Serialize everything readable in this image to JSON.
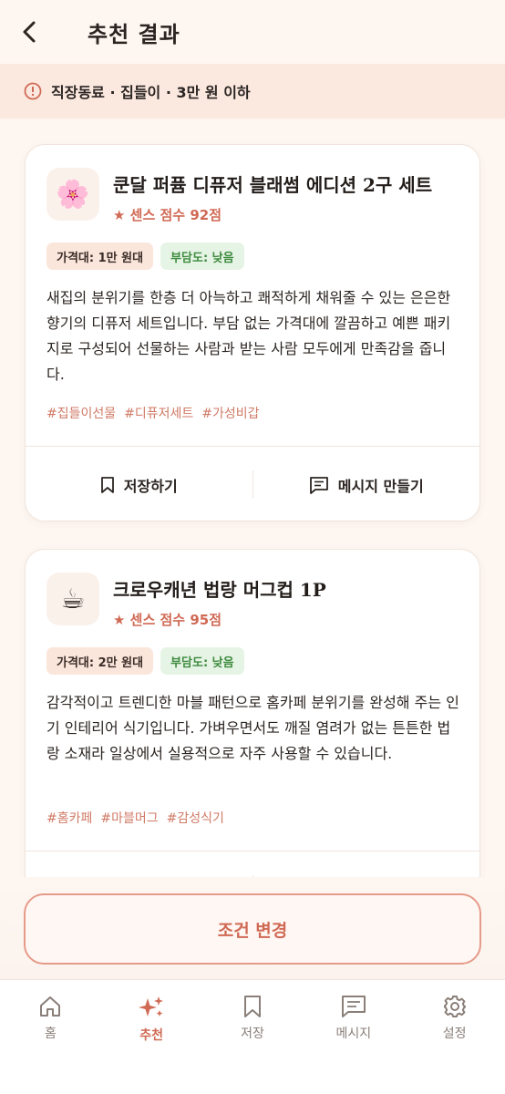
{
  "header": {
    "title": "추천 결과"
  },
  "conditions": {
    "text": "직장동료 · 집들이 · 3만 원 이하"
  },
  "products": [
    {
      "icon": "cherry-blossom-icon",
      "emoji": "🌸",
      "name": "쿤달 퍼퓸 디퓨저 블래썸 에디션 2구 세트",
      "score": "★ 센스 점수 92점",
      "price_badge": "가격대: 1만 원대",
      "burden_badge": "부담도: 낮음",
      "description": "새집의 분위기를 한층 더 아늑하고 쾌적하게 채워줄 수 있는 은은한 향기의 디퓨저 세트입니다. 부담 없는 가격대에 깔끔하고 예쁜 패키지로 구성되어 선물하는 사람과 받는 사람 모두에게 만족감을 줍니다.",
      "tags": [
        "#집들이선물",
        "#디퓨저세트",
        "#가성비갑"
      ]
    },
    {
      "icon": "coffee-cup-icon",
      "emoji": "☕",
      "name": "크로우캐년 법랑 머그컵 1P",
      "score": "★ 센스 점수 95점",
      "price_badge": "가격대: 2만 원대",
      "burden_badge": "부담도: 낮음",
      "description": "감각적이고 트렌디한 마블 패턴으로 홈카페 분위기를 완성해 주는 인기 인테리어 식기입니다. 가벼우면서도 깨질 염려가 없는 튼튼한 법랑 소재라 일상에서 실용적으로 자주 사용할 수 있습니다.",
      "tags": [
        "#홈카페",
        "#마블머그",
        "#감성식기"
      ]
    }
  ],
  "actions": {
    "save": "저장하기",
    "message": "메시지 만들기"
  },
  "cta": {
    "label": "조건 변경"
  },
  "nav": [
    {
      "label": "홈",
      "icon": "home-icon"
    },
    {
      "label": "추천",
      "icon": "sparkle-icon"
    },
    {
      "label": "저장",
      "icon": "bookmark-icon"
    },
    {
      "label": "메시지",
      "icon": "message-icon"
    },
    {
      "label": "설정",
      "icon": "gear-icon"
    }
  ],
  "colors": {
    "accent": "#d06a55",
    "background": "#fdf6f1",
    "condition_bar": "#fbe9e0"
  }
}
